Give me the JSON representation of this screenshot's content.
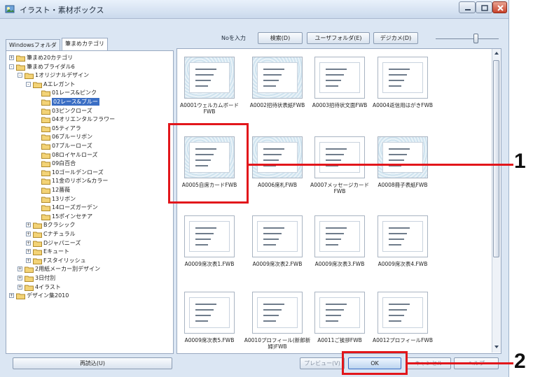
{
  "window": {
    "title": "イラスト・素材ボックス"
  },
  "toolbar": {
    "no_link": "Noを入力",
    "search": "検索(D)",
    "user_folder": "ユーザフォルダ(E)",
    "digikame": "デジカメ(D)"
  },
  "tabs": [
    "Windowsフォルダ",
    "筆まめカテゴリ"
  ],
  "tree": {
    "items": [
      {
        "label": "筆まめ20カテゴリ",
        "level": 0,
        "expander": "+"
      },
      {
        "label": "筆まめブライダル6",
        "level": 0,
        "expander": "-"
      },
      {
        "label": "1オリジナルデザイン",
        "level": 1,
        "expander": "-"
      },
      {
        "label": "Aエレガント",
        "level": 2,
        "expander": "-"
      },
      {
        "label": "01レース&ピンク",
        "level": 3,
        "expander": ""
      },
      {
        "label": "02レース&ブルー",
        "level": 3,
        "expander": "",
        "selected": true
      },
      {
        "label": "03ピンクローズ",
        "level": 3,
        "expander": ""
      },
      {
        "label": "04オリエンタルフラワー",
        "level": 3,
        "expander": ""
      },
      {
        "label": "05ティアラ",
        "level": 3,
        "expander": ""
      },
      {
        "label": "06ブルーリボン",
        "level": 3,
        "expander": ""
      },
      {
        "label": "07ブルーローズ",
        "level": 3,
        "expander": ""
      },
      {
        "label": "08ロイヤルローズ",
        "level": 3,
        "expander": ""
      },
      {
        "label": "09白百合",
        "level": 3,
        "expander": ""
      },
      {
        "label": "10ゴールデンローズ",
        "level": 3,
        "expander": ""
      },
      {
        "label": "11金のリボン&カラー",
        "level": 3,
        "expander": ""
      },
      {
        "label": "12薔薇",
        "level": 3,
        "expander": ""
      },
      {
        "label": "13リボン",
        "level": 3,
        "expander": ""
      },
      {
        "label": "14ローズガーデン",
        "level": 3,
        "expander": ""
      },
      {
        "label": "15ポインセチア",
        "level": 3,
        "expander": ""
      },
      {
        "label": "Bクラシック",
        "level": 2,
        "expander": "+"
      },
      {
        "label": "Cナチュラル",
        "level": 2,
        "expander": "+"
      },
      {
        "label": "Dジャパニーズ",
        "level": 2,
        "expander": "+"
      },
      {
        "label": "Eキュート",
        "level": 2,
        "expander": "+"
      },
      {
        "label": "Fスタイリッシュ",
        "level": 2,
        "expander": "+"
      },
      {
        "label": "2用紙メーカー別デザイン",
        "level": 1,
        "expander": "+"
      },
      {
        "label": "3日付別",
        "level": 1,
        "expander": "+"
      },
      {
        "label": "4イラスト",
        "level": 1,
        "expander": "+"
      },
      {
        "label": "デザイン集2010",
        "level": 0,
        "expander": "+"
      }
    ]
  },
  "gallery": {
    "items": [
      {
        "caption": "A0001ウェルカムボードFWB",
        "style": "lace"
      },
      {
        "caption": "A0002招待状表紙FWB",
        "style": "lace"
      },
      {
        "caption": "A0003招待状文面FWB",
        "style": "doc"
      },
      {
        "caption": "A0004返信用はがきFWB",
        "style": "doc"
      },
      {
        "caption": "A0005自席カードFWB",
        "style": "lace"
      },
      {
        "caption": "A0006席札FWB",
        "style": "lace"
      },
      {
        "caption": "A0007メッセージカードFWB",
        "style": "doc"
      },
      {
        "caption": "A0008冊子表紙FWB",
        "style": "lace"
      },
      {
        "caption": "A0009席次表1.FWB",
        "style": "doc"
      },
      {
        "caption": "A0009席次表2.FWB",
        "style": "doc"
      },
      {
        "caption": "A0009席次表3.FWB",
        "style": "doc"
      },
      {
        "caption": "A0009席次表4.FWB",
        "style": "doc"
      },
      {
        "caption": "A0009席次表5.FWB",
        "style": "doc"
      },
      {
        "caption": "A0010プロフィール(新郎新婦)FWB",
        "style": "doc"
      },
      {
        "caption": "A0011ご挨拶FWB",
        "style": "doc"
      },
      {
        "caption": "A0012プロフィールFWB",
        "style": "doc"
      }
    ]
  },
  "buttons": {
    "reload": "再読込(U)",
    "preview": "プレビュー(V)",
    "ok": "OK",
    "cancel": "キャンセル",
    "help": "ヘルプ"
  },
  "callouts": {
    "one": "1",
    "two": "2"
  },
  "colors": {
    "callout": "#e2161b",
    "selection": "#3a6ec4"
  }
}
